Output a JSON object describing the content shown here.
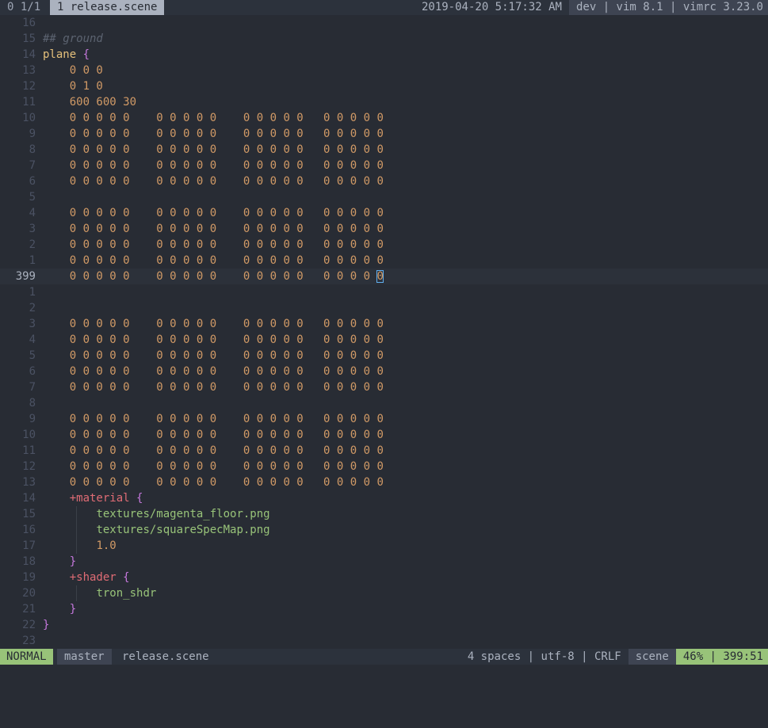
{
  "tabline": {
    "tab_count": "0 1/1",
    "active_tab": "1 release.scene",
    "datetime": "2019-04-20 5:17:32 AM",
    "right_info": "dev | vim 8.1 | vimrc 3.23.0"
  },
  "colors": {
    "background": "#282c34",
    "keyword": "#e5c07b",
    "number": "#d19a66",
    "brace": "#c678dd",
    "directive": "#e06c75",
    "string": "#98c379",
    "comment": "#5c6370",
    "line_number": "#4b5263",
    "mode_bg": "#98c379"
  },
  "editor": {
    "lines": [
      {
        "n": "16",
        "tokens": []
      },
      {
        "n": "15",
        "tokens": [
          {
            "t": "## ground",
            "c": "c-comment"
          }
        ]
      },
      {
        "n": "14",
        "tokens": [
          {
            "t": "plane",
            "c": "c-kw"
          },
          {
            "t": " "
          },
          {
            "t": "{",
            "c": "c-brace"
          }
        ]
      },
      {
        "n": "13",
        "tokens": [
          {
            "t": "    "
          },
          {
            "t": "0 0 0",
            "c": "c-num"
          }
        ]
      },
      {
        "n": "12",
        "tokens": [
          {
            "t": "    "
          },
          {
            "t": "0 1 0",
            "c": "c-num"
          }
        ]
      },
      {
        "n": "11",
        "tokens": [
          {
            "t": "    "
          },
          {
            "t": "600 600 30",
            "c": "c-num"
          }
        ]
      },
      {
        "n": "10",
        "tokens": [
          {
            "t": "    "
          },
          {
            "t": "0 0 0 0 0    0 0 0 0 0    0 0 0 0 0   0 0 0 0 0",
            "c": "c-num"
          }
        ]
      },
      {
        "n": "9",
        "tokens": [
          {
            "t": "    "
          },
          {
            "t": "0 0 0 0 0    0 0 0 0 0    0 0 0 0 0   0 0 0 0 0",
            "c": "c-num"
          }
        ]
      },
      {
        "n": "8",
        "tokens": [
          {
            "t": "    "
          },
          {
            "t": "0 0 0 0 0    0 0 0 0 0    0 0 0 0 0   0 0 0 0 0",
            "c": "c-num"
          }
        ]
      },
      {
        "n": "7",
        "tokens": [
          {
            "t": "    "
          },
          {
            "t": "0 0 0 0 0    0 0 0 0 0    0 0 0 0 0   0 0 0 0 0",
            "c": "c-num"
          }
        ]
      },
      {
        "n": "6",
        "tokens": [
          {
            "t": "    "
          },
          {
            "t": "0 0 0 0 0    0 0 0 0 0    0 0 0 0 0   0 0 0 0 0",
            "c": "c-num"
          }
        ]
      },
      {
        "n": "5",
        "tokens": []
      },
      {
        "n": "4",
        "tokens": [
          {
            "t": "    "
          },
          {
            "t": "0 0 0 0 0    0 0 0 0 0    0 0 0 0 0   0 0 0 0 0",
            "c": "c-num"
          }
        ]
      },
      {
        "n": "3",
        "tokens": [
          {
            "t": "    "
          },
          {
            "t": "0 0 0 0 0    0 0 0 0 0    0 0 0 0 0   0 0 0 0 0",
            "c": "c-num"
          }
        ]
      },
      {
        "n": "2",
        "tokens": [
          {
            "t": "    "
          },
          {
            "t": "0 0 0 0 0    0 0 0 0 0    0 0 0 0 0   0 0 0 0 0",
            "c": "c-num"
          }
        ]
      },
      {
        "n": "1",
        "tokens": [
          {
            "t": "    "
          },
          {
            "t": "0 0 0 0 0    0 0 0 0 0    0 0 0 0 0   0 0 0 0 0",
            "c": "c-num"
          }
        ]
      },
      {
        "n": "399",
        "current": true,
        "tokens": [
          {
            "t": "    "
          },
          {
            "t": "0 0 0 0 0    0 0 0 0 0    0 0 0 0 0   0 0 0 0 ",
            "c": "c-num"
          },
          {
            "t": "0",
            "c": "c-num cursor"
          }
        ]
      },
      {
        "n": "1",
        "tokens": []
      },
      {
        "n": "2",
        "tokens": []
      },
      {
        "n": "3",
        "tokens": [
          {
            "t": "    "
          },
          {
            "t": "0 0 0 0 0    0 0 0 0 0    0 0 0 0 0   0 0 0 0 0",
            "c": "c-num"
          }
        ]
      },
      {
        "n": "4",
        "tokens": [
          {
            "t": "    "
          },
          {
            "t": "0 0 0 0 0    0 0 0 0 0    0 0 0 0 0   0 0 0 0 0",
            "c": "c-num"
          }
        ]
      },
      {
        "n": "5",
        "tokens": [
          {
            "t": "    "
          },
          {
            "t": "0 0 0 0 0    0 0 0 0 0    0 0 0 0 0   0 0 0 0 0",
            "c": "c-num"
          }
        ]
      },
      {
        "n": "6",
        "tokens": [
          {
            "t": "    "
          },
          {
            "t": "0 0 0 0 0    0 0 0 0 0    0 0 0 0 0   0 0 0 0 0",
            "c": "c-num"
          }
        ]
      },
      {
        "n": "7",
        "tokens": [
          {
            "t": "    "
          },
          {
            "t": "0 0 0 0 0    0 0 0 0 0    0 0 0 0 0   0 0 0 0 0",
            "c": "c-num"
          }
        ]
      },
      {
        "n": "8",
        "tokens": []
      },
      {
        "n": "9",
        "tokens": [
          {
            "t": "    "
          },
          {
            "t": "0 0 0 0 0    0 0 0 0 0    0 0 0 0 0   0 0 0 0 0",
            "c": "c-num"
          }
        ]
      },
      {
        "n": "10",
        "tokens": [
          {
            "t": "    "
          },
          {
            "t": "0 0 0 0 0    0 0 0 0 0    0 0 0 0 0   0 0 0 0 0",
            "c": "c-num"
          }
        ]
      },
      {
        "n": "11",
        "tokens": [
          {
            "t": "    "
          },
          {
            "t": "0 0 0 0 0    0 0 0 0 0    0 0 0 0 0   0 0 0 0 0",
            "c": "c-num"
          }
        ]
      },
      {
        "n": "12",
        "tokens": [
          {
            "t": "    "
          },
          {
            "t": "0 0 0 0 0    0 0 0 0 0    0 0 0 0 0   0 0 0 0 0",
            "c": "c-num"
          }
        ]
      },
      {
        "n": "13",
        "tokens": [
          {
            "t": "    "
          },
          {
            "t": "0 0 0 0 0    0 0 0 0 0    0 0 0 0 0   0 0 0 0 0",
            "c": "c-num"
          }
        ]
      },
      {
        "n": "14",
        "tokens": [
          {
            "t": "    "
          },
          {
            "t": "+material",
            "c": "c-red"
          },
          {
            "t": " "
          },
          {
            "t": "{",
            "c": "c-brace"
          }
        ]
      },
      {
        "n": "15",
        "guide": true,
        "tokens": [
          {
            "t": "        "
          },
          {
            "t": "textures/magenta_floor.png",
            "c": "c-str"
          }
        ]
      },
      {
        "n": "16",
        "guide": true,
        "tokens": [
          {
            "t": "        "
          },
          {
            "t": "textures/squareSpecMap.png",
            "c": "c-str"
          }
        ]
      },
      {
        "n": "17",
        "guide": true,
        "tokens": [
          {
            "t": "        "
          },
          {
            "t": "1.0",
            "c": "c-num"
          }
        ]
      },
      {
        "n": "18",
        "tokens": [
          {
            "t": "    "
          },
          {
            "t": "}",
            "c": "c-brace"
          }
        ]
      },
      {
        "n": "19",
        "tokens": [
          {
            "t": "    "
          },
          {
            "t": "+shader",
            "c": "c-red"
          },
          {
            "t": " "
          },
          {
            "t": "{",
            "c": "c-brace"
          }
        ]
      },
      {
        "n": "20",
        "guide": true,
        "tokens": [
          {
            "t": "        "
          },
          {
            "t": "tron_shdr",
            "c": "c-str"
          }
        ]
      },
      {
        "n": "21",
        "tokens": [
          {
            "t": "    "
          },
          {
            "t": "}",
            "c": "c-brace"
          }
        ]
      },
      {
        "n": "22",
        "tokens": [
          {
            "t": "}",
            "c": "c-brace"
          }
        ]
      },
      {
        "n": "23",
        "tokens": []
      }
    ]
  },
  "statusline": {
    "mode": "NORMAL",
    "branch": "master",
    "filename": "release.scene",
    "format": "4 spaces | utf-8 | CRLF",
    "filetype": "scene",
    "position": "46% | 399:51"
  }
}
